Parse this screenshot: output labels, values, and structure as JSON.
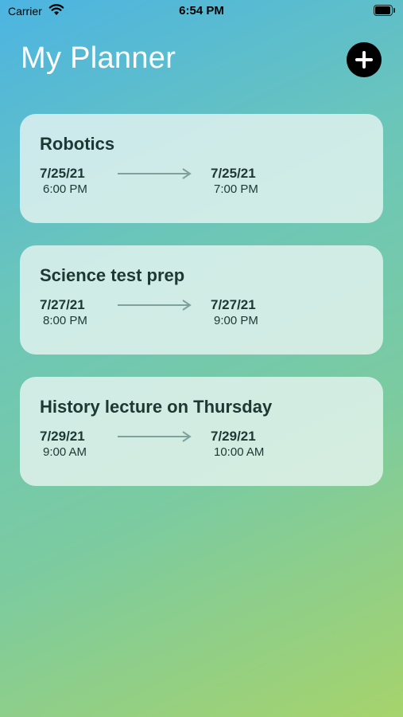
{
  "status_bar": {
    "carrier": "Carrier",
    "time": "6:54 PM",
    "icons": [
      "wifi-icon",
      "battery-icon"
    ]
  },
  "header": {
    "title": "My Planner",
    "add_icon": "plus-circle-icon"
  },
  "colors": {
    "background_gradient": [
      "#4cb4e2",
      "#6cc6b8",
      "#7ccba0",
      "#a6d36c"
    ],
    "title_text": "#ffffff",
    "card_text": "#1d3833",
    "arrow": "#7fa19b",
    "add_button": "#000000"
  },
  "events": [
    {
      "title": "Robotics",
      "start_date": "7/25/21",
      "start_time": "6:00 PM",
      "end_date": "7/25/21",
      "end_time": "7:00 PM"
    },
    {
      "title": "Science test prep",
      "start_date": "7/27/21",
      "start_time": "8:00 PM",
      "end_date": "7/27/21",
      "end_time": "9:00 PM"
    },
    {
      "title": "History lecture on Thursday",
      "start_date": "7/29/21",
      "start_time": "9:00 AM",
      "end_date": "7/29/21",
      "end_time": "10:00 AM"
    }
  ]
}
